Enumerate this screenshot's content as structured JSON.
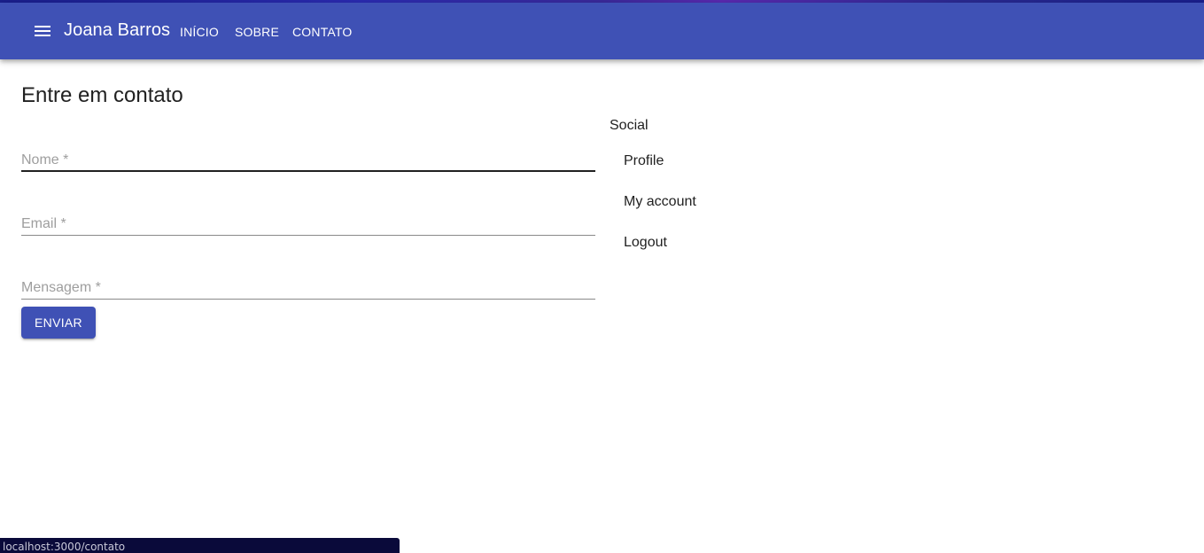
{
  "header": {
    "brand": "Joana Barros",
    "nav": [
      "INÍCIO",
      "SOBRE",
      "CONTATO"
    ]
  },
  "main": {
    "title": "Entre em contato",
    "fields": {
      "name_label": "Nome *",
      "email_label": "Email *",
      "message_label": "Mensagem *"
    },
    "submit_label": "ENVIAR"
  },
  "social": {
    "heading": "Social",
    "items": [
      "Profile",
      "My account",
      "Logout"
    ]
  },
  "statusbar": {
    "url": "localhost:3000/contato"
  },
  "colors": {
    "primary": "#3f51b5",
    "text": "#212121",
    "placeholder": "#9e9e9e"
  },
  "icons": {
    "menu": "menu-icon"
  }
}
